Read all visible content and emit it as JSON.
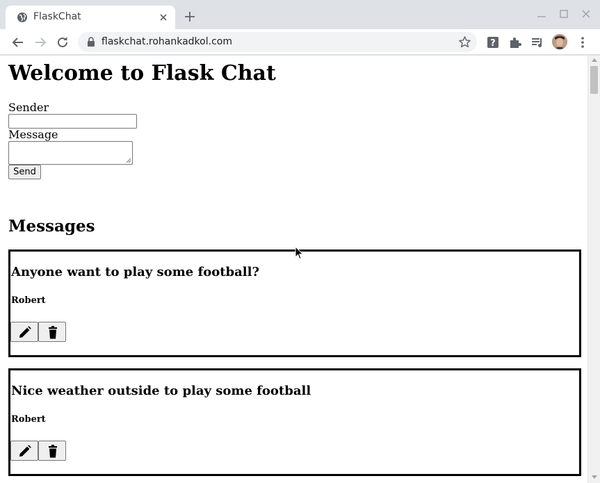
{
  "browser": {
    "tab_title": "FlaskChat",
    "url": "flaskchat.rohankadkol.com"
  },
  "page": {
    "title": "Welcome to Flask Chat",
    "form": {
      "sender_label": "Sender",
      "sender_value": "",
      "message_label": "Message",
      "message_value": "",
      "send_label": "Send"
    },
    "messages_heading": "Messages",
    "messages": [
      {
        "text": "Anyone want to play some football?",
        "sender": "Robert"
      },
      {
        "text": "Nice weather outside to play some football",
        "sender": "Robert"
      }
    ]
  },
  "icons": {
    "tab": [
      "globe-icon",
      "close-icon",
      "new-tab-icon"
    ],
    "window": [
      "minimize-icon",
      "maximize-icon",
      "close-window-icon"
    ],
    "toolbar": [
      "back-icon",
      "forward-icon",
      "reload-icon",
      "lock-icon",
      "star-icon",
      "help-extension-icon",
      "puzzle-icon",
      "media-queue-icon",
      "profile-avatar",
      "more-icon"
    ],
    "message_actions": [
      "edit-pencil-icon",
      "delete-trash-icon"
    ]
  },
  "colors": {
    "tabstrip_bg": "#dee1e6",
    "omnibox_bg": "#f1f3f4",
    "card_border": "#000000",
    "button_bg": "#efefef"
  }
}
